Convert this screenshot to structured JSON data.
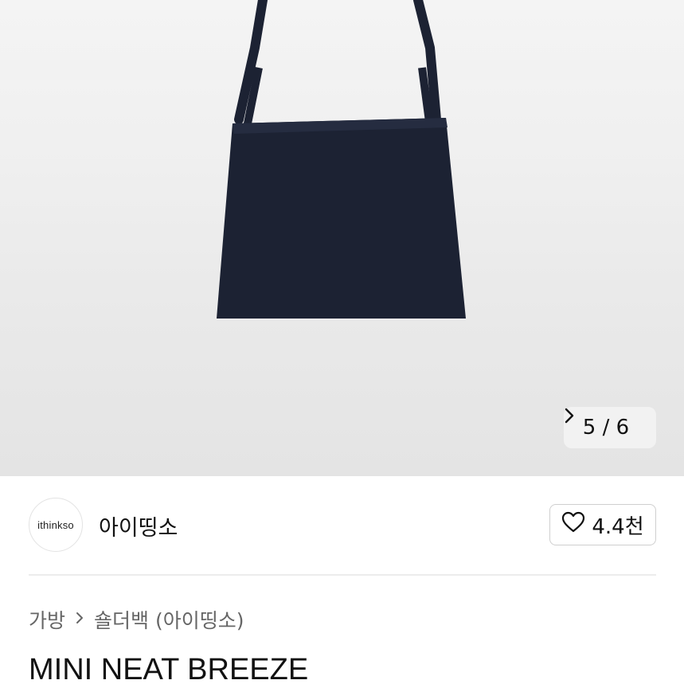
{
  "gallery": {
    "current": "5",
    "total": "6",
    "separator": "/",
    "product_image": "navy-shoulder-bag"
  },
  "seller": {
    "logo_text": "ithinkso",
    "name": "아이띵소",
    "like_count": "4.4천",
    "like_icon": "heart-icon"
  },
  "breadcrumb": {
    "category": "가방",
    "subcategory": "숄더백 (아이띵소)"
  },
  "product": {
    "title": "MINI NEAT BREEZE"
  },
  "colors": {
    "bag": "#1c2233",
    "text": "#111111",
    "muted": "#666666"
  }
}
